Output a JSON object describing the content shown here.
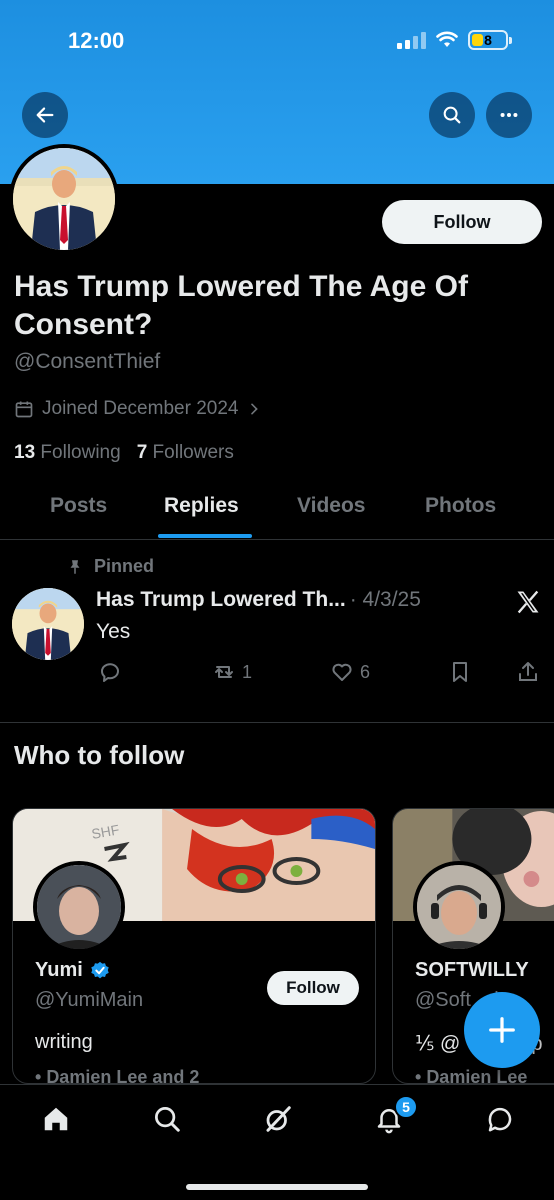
{
  "status_bar": {
    "time": "12:00",
    "battery": "8"
  },
  "profile": {
    "follow_label": "Follow",
    "name": "Has Trump Lowered The Age Of Consent?",
    "handle": "@ConsentThief",
    "joined": "Joined December 2024",
    "following_count": "13",
    "following_label": "Following",
    "followers_count": "7",
    "followers_label": "Followers"
  },
  "tabs": [
    {
      "label": "Posts"
    },
    {
      "label": "Replies"
    },
    {
      "label": "Videos"
    },
    {
      "label": "Photos"
    }
  ],
  "active_tab": "Replies",
  "pinned_post": {
    "pinned_label": "Pinned",
    "author": "Has Trump Lowered Th...",
    "date": "· 4/3/25",
    "text": "Yes",
    "retweets": "1",
    "likes": "6"
  },
  "who_to_follow": {
    "title": "Who to follow",
    "cards": [
      {
        "name": "Yumi",
        "verified": true,
        "handle": "@YumiMain",
        "bio": "writing",
        "mutual": "Damien Lee and 2",
        "follow_label": "Follow"
      },
      {
        "name": "SOFTWILLY",
        "handle": "@Soft",
        "handle_tail": "ly",
        "bio": "⅕ @",
        "bio_tail": "up",
        "mutual": "Damien Lee"
      }
    ]
  },
  "nav": {
    "notifications_badge": "5"
  },
  "colors": {
    "accent": "#1d9bf0",
    "background": "#000000",
    "banner": "#2a9df0"
  }
}
